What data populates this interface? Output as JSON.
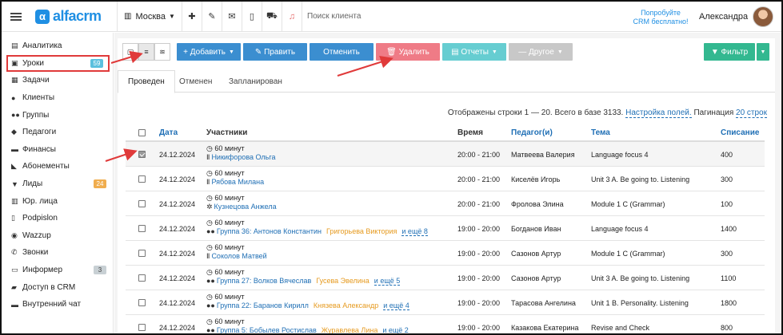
{
  "topbar": {
    "logo_text": "alfacrm",
    "branch": "Москва",
    "search_placeholder": "Поиск клиента",
    "promo_line1": "Попробуйте",
    "promo_line2": "CRM бесплатно!",
    "user_name": "Александра"
  },
  "sidebar": {
    "items": [
      {
        "label": "Аналитика",
        "icon": "chart-icon",
        "glyph": "▤"
      },
      {
        "label": "Уроки",
        "icon": "calendar-icon",
        "glyph": "▣",
        "badge": "59",
        "badge_color": "#5bc0de"
      },
      {
        "label": "Задачи",
        "icon": "tasks-icon",
        "glyph": "▦"
      },
      {
        "label": "Клиенты",
        "icon": "user-icon",
        "glyph": "●"
      },
      {
        "label": "Группы",
        "icon": "users-icon",
        "glyph": "●●"
      },
      {
        "label": "Педагоги",
        "icon": "graduation-cap-icon",
        "glyph": "◆"
      },
      {
        "label": "Финансы",
        "icon": "money-icon",
        "glyph": "▬"
      },
      {
        "label": "Абонементы",
        "icon": "tag-icon",
        "glyph": "◣"
      },
      {
        "label": "Лиды",
        "icon": "funnel-icon",
        "glyph": "▼",
        "badge": "24",
        "badge_color": "#f0ad4e"
      },
      {
        "label": "Юр. лица",
        "icon": "building-icon",
        "glyph": "▥"
      },
      {
        "label": "Podpislon",
        "icon": "document-icon",
        "glyph": "▯"
      },
      {
        "label": "Wazzup",
        "icon": "whatsapp-icon",
        "glyph": "◉"
      },
      {
        "label": "Звонки",
        "icon": "phone-icon",
        "glyph": "✆"
      },
      {
        "label": "Информер",
        "icon": "info-icon",
        "glyph": "▭",
        "badge": "3",
        "badge_color": "#c8d0d4"
      },
      {
        "label": "Доступ в CRM",
        "icon": "lock-icon",
        "glyph": "▰"
      },
      {
        "label": "Внутренний чат",
        "icon": "chat-icon",
        "glyph": "▬"
      }
    ]
  },
  "toolbar": {
    "add": "+ Добавить",
    "edit": "✎ Править",
    "cancel": "Отменить",
    "delete": "🗑 Удалить",
    "reports": "▤ Отчеты",
    "other": "— Другое",
    "filter": "▼ Фильтр"
  },
  "tabs": [
    "Проведен",
    "Отменен",
    "Запланирован"
  ],
  "info": {
    "text": "Отображены строки 1 — 20. Всего в базе 3133.",
    "settings_link": "Настройка полей.",
    "pagination_label": "Пагинация",
    "pagination_value": "20 строк"
  },
  "table": {
    "headers": {
      "date": "Дата",
      "participants": "Участники",
      "time": "Время",
      "teacher": "Педагог(и)",
      "topic": "Тема",
      "writeoff": "Списание"
    },
    "rows": [
      {
        "checked": true,
        "date": "24.12.2024",
        "duration": "60 минут",
        "p_icon": "Ⅱ",
        "participant": "Никифорова Ольга",
        "extra": "",
        "more": "",
        "time": "20:00 - 21:00",
        "teacher": "Матвеева Валерия",
        "topic": "Language focus 4",
        "writeoff": "400"
      },
      {
        "checked": false,
        "date": "24.12.2024",
        "duration": "60 минут",
        "p_icon": "Ⅱ",
        "participant": "Рябова Милана",
        "extra": "",
        "more": "",
        "time": "20:00 - 21:00",
        "teacher": "Киселёв Игорь",
        "topic": "Unit 3 A. Be going to. Listening",
        "writeoff": "300"
      },
      {
        "checked": false,
        "date": "24.12.2024",
        "duration": "60 минут",
        "p_icon": "✲",
        "participant": "Кузнецова Анжела",
        "extra": "",
        "more": "",
        "time": "20:00 - 21:00",
        "teacher": "Фролова Элина",
        "topic": "Module 1 C (Grammar)",
        "writeoff": "100"
      },
      {
        "checked": false,
        "date": "24.12.2024",
        "duration": "60 минут",
        "p_icon": "●●",
        "participant": "Группа 36: Антонов Константин",
        "extra": "Григорьева Виктория",
        "more": "и ещё 8",
        "time": "19:00 - 20:00",
        "teacher": "Богданов Иван",
        "topic": "Language focus 4",
        "writeoff": "1400"
      },
      {
        "checked": false,
        "date": "24.12.2024",
        "duration": "60 минут",
        "p_icon": "Ⅱ",
        "participant": "Соколов Матвей",
        "extra": "",
        "more": "",
        "time": "19:00 - 20:00",
        "teacher": "Сазонов Артур",
        "topic": "Module 1 C (Grammar)",
        "writeoff": "300"
      },
      {
        "checked": false,
        "date": "24.12.2024",
        "duration": "60 минут",
        "p_icon": "●●",
        "participant": "Группа 27: Волков Вячеслав",
        "extra": "Гусева Эвелина",
        "more": "и ещё 5",
        "time": "19:00 - 20:00",
        "teacher": "Сазонов Артур",
        "topic": "Unit 3 A. Be going to. Listening",
        "writeoff": "1100"
      },
      {
        "checked": false,
        "date": "24.12.2024",
        "duration": "60 минут",
        "p_icon": "●●",
        "participant": "Группа 22: Баранов Кирилл",
        "extra": "Князева Александр",
        "more": "и ещё 4",
        "time": "19:00 - 20:00",
        "teacher": "Тарасова Ангелина",
        "topic": "Unit 1 B. Personality. Listening",
        "writeoff": "1800"
      },
      {
        "checked": false,
        "date": "24.12.2024",
        "duration": "60 минут",
        "p_icon": "●●",
        "participant": "Группа 5: Бобылев Ростислав",
        "extra": "Журавлева Лина",
        "more": "и ещё 2",
        "time": "19:00 - 20:00",
        "teacher": "Казакова Екатерина",
        "topic": "Revise and Check",
        "writeoff": "800"
      }
    ]
  },
  "colors": {
    "accent": "#1f8fe3",
    "link": "#1f6fb5",
    "annotation": "#e03a3a",
    "btn_blue": "#3b8ed0",
    "btn_red": "#ef7b86",
    "btn_teal": "#66cdd1",
    "btn_green": "#33b890"
  }
}
